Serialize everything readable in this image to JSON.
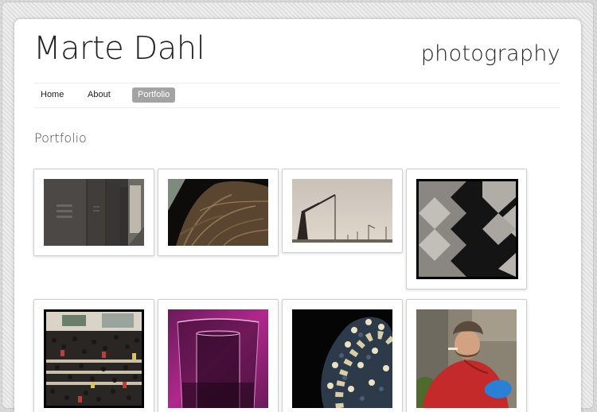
{
  "site": {
    "title": "Marte Dahl",
    "tagline": "photography"
  },
  "nav": {
    "items": [
      {
        "label": "Home",
        "active": false
      },
      {
        "label": "About",
        "active": false
      },
      {
        "label": "Portfolio",
        "active": true
      }
    ],
    "active_color": "#a3a3a3"
  },
  "main": {
    "heading": "Portfolio"
  },
  "gallery": {
    "items": [
      {
        "subject": "lockers-corridor"
      },
      {
        "subject": "tree-roots"
      },
      {
        "subject": "construction-crane"
      },
      {
        "subject": "concrete-steps-shadow"
      },
      {
        "subject": "crowd-crossing"
      },
      {
        "subject": "wine-glass-purple"
      },
      {
        "subject": "snake-closeup"
      },
      {
        "subject": "man-red-jacket"
      }
    ]
  }
}
